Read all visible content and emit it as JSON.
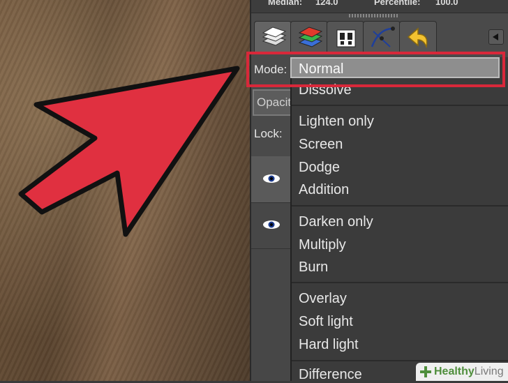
{
  "stats": {
    "median_label": "Median:",
    "median_value": "124.0",
    "percentile_label": "Percentile:",
    "percentile_value": "100.0"
  },
  "tabs": [
    {
      "name": "layers-tab",
      "icon": "layers-icon"
    },
    {
      "name": "channels-tab",
      "icon": "channels-icon"
    },
    {
      "name": "paths-tab",
      "icon": "paths-icon"
    },
    {
      "name": "colormap-tab",
      "icon": "colormap-icon"
    },
    {
      "name": "undo-history-tab",
      "icon": "undo-icon"
    }
  ],
  "panel": {
    "mode_label": "Mode:",
    "opacity_label": "Opacit",
    "lock_label": "Lock:"
  },
  "mode_dropdown": {
    "selected": "Normal",
    "groups": [
      [
        "Dissolve"
      ],
      [
        "Lighten only",
        "Screen",
        "Dodge",
        "Addition"
      ],
      [
        "Darken only",
        "Multiply",
        "Burn"
      ],
      [
        "Overlay",
        "Soft light",
        "Hard light"
      ],
      [
        "Difference"
      ]
    ]
  },
  "watermark": {
    "brand_bold": "Healthy",
    "brand_light": "Living"
  },
  "colors": {
    "highlight": "#d8283a",
    "arrow": "#e03040"
  }
}
